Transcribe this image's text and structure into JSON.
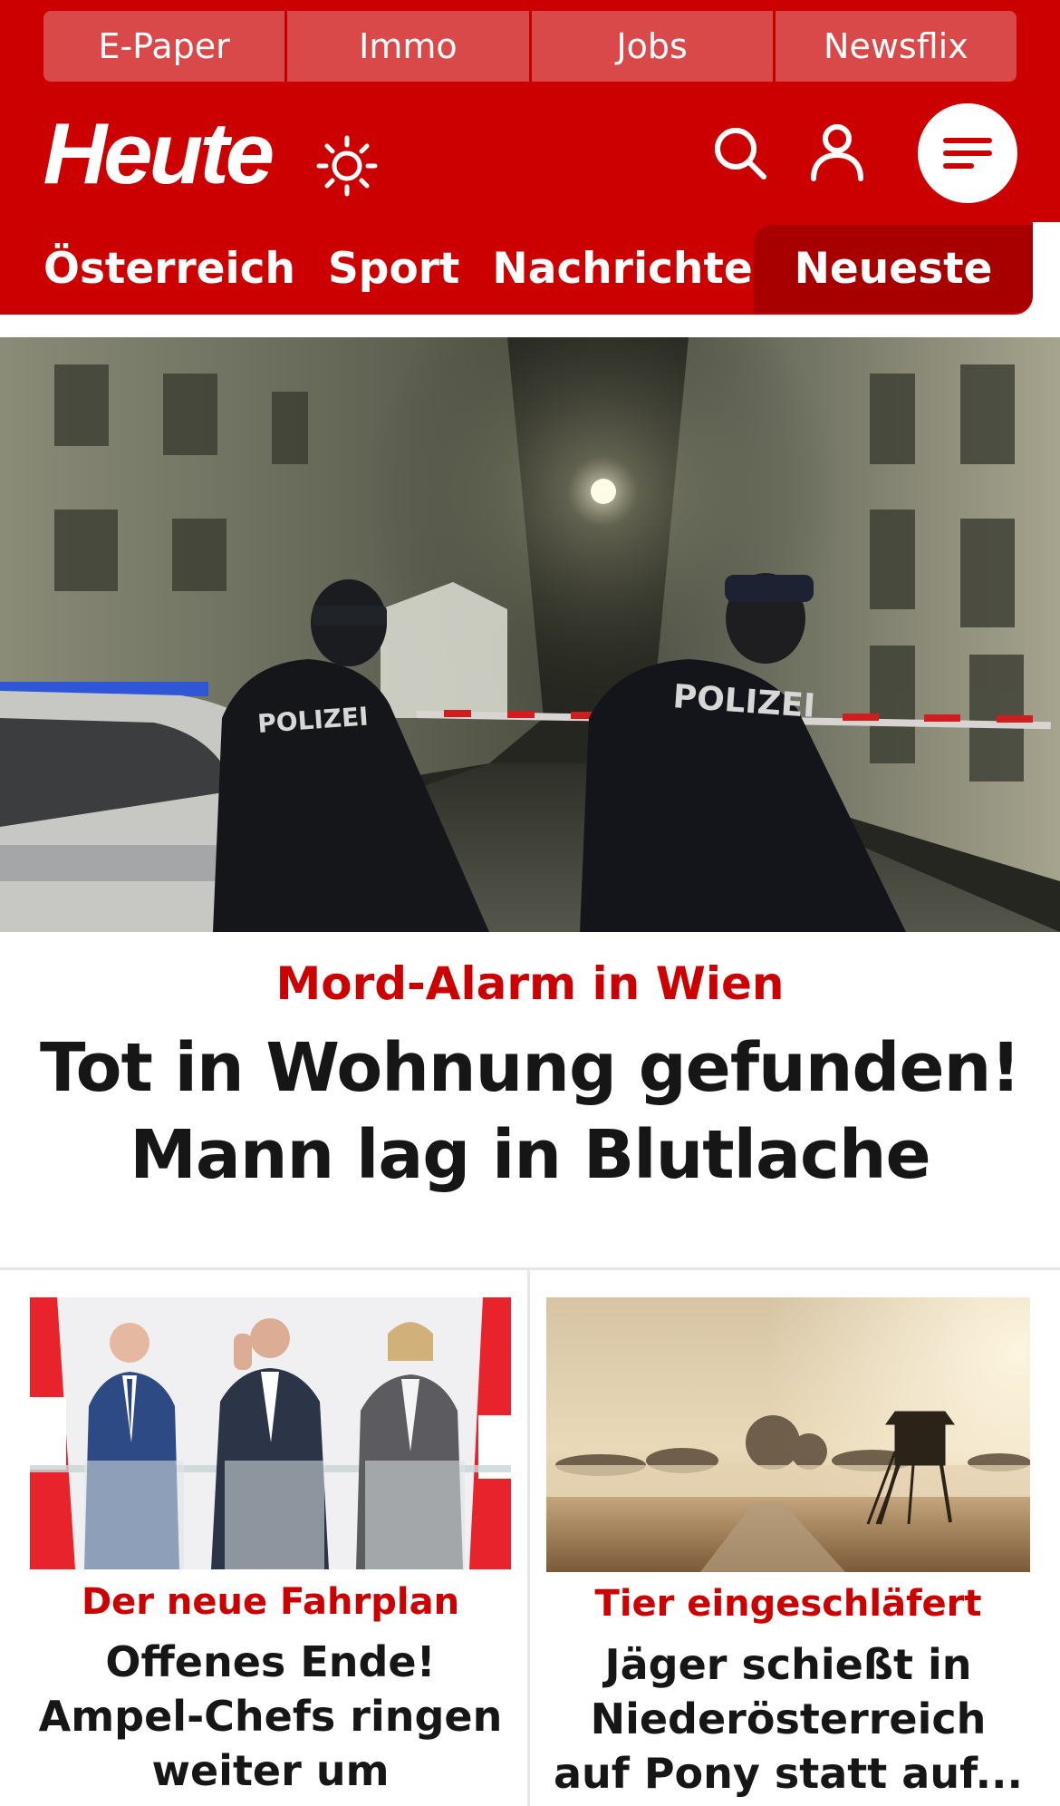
{
  "quicklinks": [
    {
      "label": "E-Paper"
    },
    {
      "label": "Immo"
    },
    {
      "label": "Jobs"
    },
    {
      "label": "Newsflix"
    }
  ],
  "header": {
    "logo_text": "Heute",
    "icons": [
      "sun-icon",
      "search-icon",
      "user-icon",
      "menu-icon"
    ]
  },
  "nav": {
    "items": [
      {
        "label": "Österreich"
      },
      {
        "label": "Sport"
      },
      {
        "label": "Nachrichten"
      }
    ],
    "active_label": "Neueste"
  },
  "hero": {
    "kicker": "Mord-Alarm in Wien",
    "title": "Tot in Wohnung gefunden! Mann lag in Blutlache",
    "image_text": "POLIZEI"
  },
  "cards": [
    {
      "kicker": "Der neue Fahrplan",
      "title": "Offenes Ende! Ampel-Chefs ringen weiter um Regierung"
    },
    {
      "kicker": "Tier eingeschläfert",
      "title": "Jäger schießt in Niederösterreich auf Pony statt auf..."
    }
  ],
  "colors": {
    "brand_red": "#cc0000",
    "nav_active_red": "#a80000",
    "quicklink_red": "#d94949",
    "headline": "#161616"
  }
}
